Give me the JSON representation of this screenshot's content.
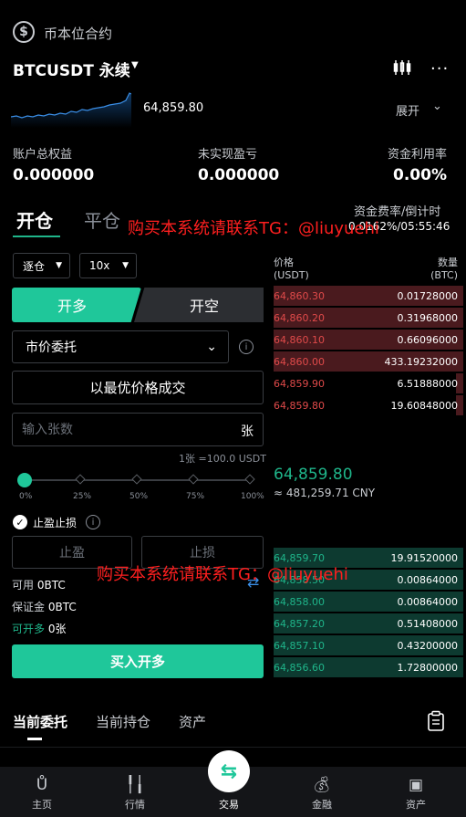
{
  "header": {
    "section_title": "币本位合约",
    "pair": "BTCUSDT 永续",
    "spark_price": "64,859.80",
    "expand_label": "展开"
  },
  "stats": [
    {
      "label": "账户总权益",
      "value": "0.000000"
    },
    {
      "label": "未实现盈亏",
      "value": "0.000000"
    },
    {
      "label": "资金利用率",
      "value": "0.00%"
    }
  ],
  "tabs": {
    "open": "开仓",
    "close": "平仓"
  },
  "funding": {
    "label": "资金费率/倒计时",
    "value": "0.0162%/05:55:46"
  },
  "form": {
    "margin_mode": "逐仓",
    "leverage": "10x",
    "buy_tab": "开多",
    "sell_tab": "开空",
    "order_type": "市价委托",
    "best_price": "以最优价格成交",
    "qty_placeholder": "输入张数",
    "qty_unit": "张",
    "contract_note": "1张 =100.0 USDT",
    "slider_level": 0,
    "slider_labels": [
      "0%",
      "25%",
      "50%",
      "75%",
      "100%"
    ],
    "tpsl_label": "止盈止损",
    "tp_label": "止盈",
    "sl_label": "止损",
    "available_label": "可用",
    "available_value": "0BTC",
    "margin_label": "保证金",
    "margin_value": "0BTC",
    "can_open_label": "可开多",
    "can_open_value": "0张",
    "buy_button": "买入开多"
  },
  "orderbook": {
    "price_header": "价格",
    "price_unit": "(USDT)",
    "qty_header": "数量",
    "qty_unit": "(BTC)",
    "asks": [
      {
        "price": "64,860.30",
        "qty": "0.01728000",
        "depth": 1.0
      },
      {
        "price": "64,860.20",
        "qty": "0.31968000",
        "depth": 1.0
      },
      {
        "price": "64,860.10",
        "qty": "0.66096000",
        "depth": 1.0
      },
      {
        "price": "64,860.00",
        "qty": "433.19232000",
        "depth": 1.0
      },
      {
        "price": "64,859.90",
        "qty": "6.51888000",
        "depth": 0.04
      },
      {
        "price": "64,859.80",
        "qty": "19.60848000",
        "depth": 0.04
      }
    ],
    "mid_price": "64,859.80",
    "mid_cny": "≈ 481,259.71 CNY",
    "bids": [
      {
        "price": "64,859.70",
        "qty": "19.91520000",
        "depth": 1.0
      },
      {
        "price": "64,858.50",
        "qty": "0.00864000",
        "depth": 1.0
      },
      {
        "price": "64,858.00",
        "qty": "0.00864000",
        "depth": 1.0
      },
      {
        "price": "64,857.20",
        "qty": "0.51408000",
        "depth": 1.0
      },
      {
        "price": "64,857.10",
        "qty": "0.43200000",
        "depth": 1.0
      },
      {
        "price": "64,856.60",
        "qty": "1.72800000",
        "depth": 1.0
      }
    ]
  },
  "bottom_tabs": [
    "当前委托",
    "当前持仓",
    "资产"
  ],
  "nav": [
    "主页",
    "行情",
    "交易",
    "金融",
    "资产"
  ],
  "watermark": "购买本系统请联系TG：@liuyuehi",
  "colors": {
    "accent": "#1fc79a",
    "ask_bg": "#4a1a1e",
    "bid_bg": "#0d3a30",
    "watermark": "#ff1f1f"
  },
  "icons": [
    "dollar-circle-icon",
    "caret-down-icon",
    "candlestick-icon",
    "more-icon",
    "chevron-down-icon",
    "info-icon",
    "check-icon",
    "swap-icon",
    "clipboard-icon",
    "home-icon",
    "market-icon",
    "trade-icon",
    "finance-icon",
    "wallet-icon"
  ]
}
